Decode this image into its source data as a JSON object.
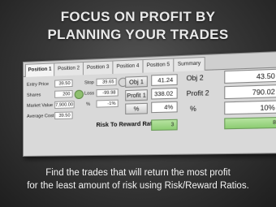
{
  "headline": {
    "line1": "FOCUS ON PROFIT BY",
    "line2": "PLANNING YOUR TRADES"
  },
  "tabs": [
    "Position 1",
    "Position 2",
    "Position 3",
    "Position 4",
    "Position 5",
    "Summary"
  ],
  "left_fields": [
    {
      "label": "Entry Price",
      "value": "39.50"
    },
    {
      "label": "Shares",
      "value": "200"
    },
    {
      "label": "Market Value",
      "value": "7,900.00"
    },
    {
      "label": "Average Cost",
      "value": "39.50"
    }
  ],
  "stop": {
    "label": "Stop",
    "value": "39.65"
  },
  "loss": {
    "label": "Loss",
    "value": "-99.98"
  },
  "pct_small": {
    "label": "%",
    "value": "-1%"
  },
  "obj1": {
    "label": "Obj 1",
    "value": "41.24"
  },
  "profit1": {
    "label": "Profit 1",
    "value": "338.02"
  },
  "pct1": {
    "label": "%",
    "value": "4%"
  },
  "obj2": {
    "label": "Obj 2",
    "value": "43.50"
  },
  "profit2": {
    "label": "Profit 2",
    "value": "790.02"
  },
  "pct2": {
    "label": "%",
    "value": "10%"
  },
  "risk_reward": {
    "label": "Risk To Reward Ratio",
    "value1": "3",
    "value2": "8"
  },
  "caption": {
    "line1": "Find the trades that will return the most profit",
    "line2": "for the least amount of risk using Risk/Reward Ratios."
  },
  "colors": {
    "accent_green": "#8ccc72",
    "background": "#3a3a3a"
  }
}
